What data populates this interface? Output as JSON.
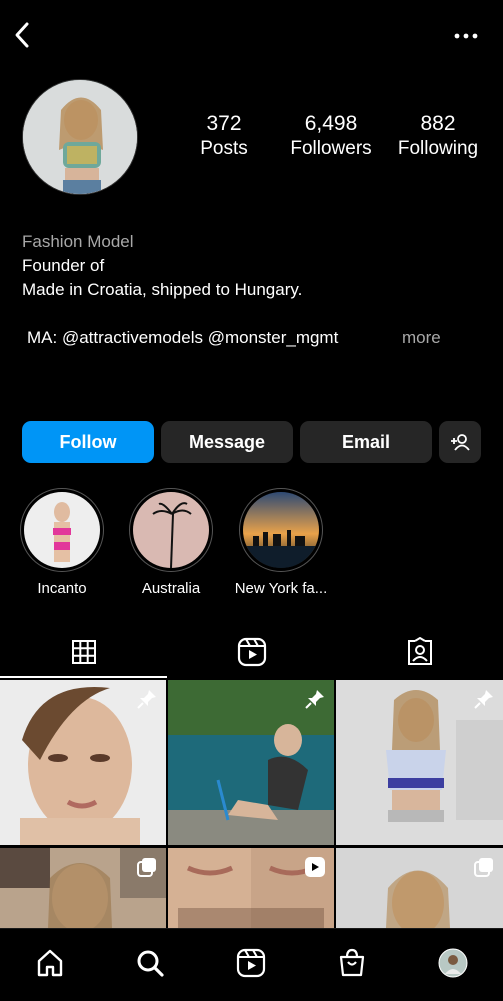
{
  "header": {
    "back_icon": "back-arrow-icon",
    "more_icon": "more-dots-icon"
  },
  "profile": {
    "stats": [
      {
        "value": "372",
        "label": "Posts"
      },
      {
        "value": "6,498",
        "label": "Followers"
      },
      {
        "value": "882",
        "label": "Following"
      }
    ],
    "bio": {
      "category": "Fashion Model",
      "line1": "Founder of",
      "line2": "Made in Croatia, shipped to Hungary.",
      "line3": "MA: @attractivemodels @monster_mgmt",
      "more": "more"
    }
  },
  "actions": {
    "follow": "Follow",
    "message": "Message",
    "email": "Email",
    "suggest_icon": "add-person-icon",
    "accent": "#0095f6"
  },
  "highlights": [
    {
      "label": "Incanto"
    },
    {
      "label": "Australia"
    },
    {
      "label": "New York fa..."
    }
  ],
  "tabs": [
    {
      "icon": "grid-icon",
      "active": true
    },
    {
      "icon": "reels-icon",
      "active": false
    },
    {
      "icon": "tagged-icon",
      "active": false
    }
  ],
  "posts": [
    {
      "type": "photo",
      "pinned": true
    },
    {
      "type": "photo",
      "pinned": true
    },
    {
      "type": "photo",
      "pinned": true
    },
    {
      "type": "carousel",
      "pinned": false
    },
    {
      "type": "reel",
      "pinned": false
    },
    {
      "type": "carousel",
      "pinned": false
    }
  ],
  "bottom_nav": [
    "home-icon",
    "search-icon",
    "reels-icon",
    "shop-icon",
    "profile-avatar"
  ]
}
